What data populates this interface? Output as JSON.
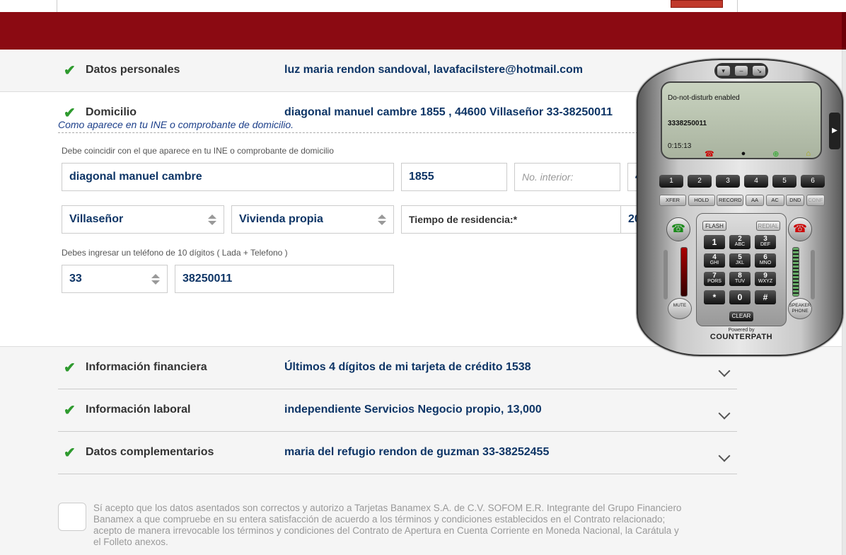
{
  "colors": {
    "brand_red": "#8b0a12",
    "value_blue": "#0e3566",
    "check_green": "#2e9a2e"
  },
  "sections": {
    "personal": {
      "title": "Datos personales",
      "value": "luz maria rendon sandoval, lavafacilstere@hotmail.com"
    },
    "domicilio": {
      "title": "Domicilio",
      "value": "diagonal manuel cambre 1855 , 44600 Villaseñor 33-38250011",
      "subtitle": "Como aparece en tu INE o comprobante de domicilio.",
      "helper": "Debe coincidir con el que aparece en tu INE o comprobante de domicilio",
      "street": "diagonal manuel cambre",
      "ext_number": "1855",
      "int_number_placeholder": "No. interior:",
      "partial_field": "4",
      "colonia": "Villaseñor",
      "housing": "Vivienda propia",
      "residence_label": "Tiempo de residencia:*",
      "residence_value": "20",
      "phone_helper": "Debes ingresar un teléfono de 10 dígitos ( Lada + Telefono )",
      "lada": "33",
      "phone": "38250011"
    },
    "financial": {
      "title": "Información financiera",
      "value": "Últimos 4 dígitos de mi tarjeta de crédito 1538"
    },
    "labor": {
      "title": "Información laboral",
      "value": "independiente Servicios Negocio propio, 13,000"
    },
    "complementary": {
      "title": "Datos complementarios",
      "value": "maria del refugio rendon de guzman 33-38252455"
    }
  },
  "consent": {
    "text": "Sí acepto que los datos asentados son correctos y autorizo a Tarjetas Banamex S.A. de C.V. SOFOM E.R. Integrante del Grupo Financiero Banamex a que compruebe en su entera satisfacción de acuerdo a los términos y condiciones establecidos en el Contrato relacionado; acepto de manera irrevocable los términos y condiciones del Contrato de Apertura en Cuenta Corriente en Moneda Nacional, la Carátula y el Folleto anexos."
  },
  "softphone": {
    "status": "Do-not-disturb enabled",
    "number": "3338250011",
    "timer": "0:15:13",
    "lines": [
      "1",
      "2",
      "3",
      "4",
      "5",
      "6"
    ],
    "features": [
      "XFER",
      "HOLD",
      "RECORD",
      "AA",
      "AC",
      "DND",
      "CONF"
    ],
    "flash": "FLASH",
    "redial": "REDIAL",
    "keys": [
      {
        "d": "1",
        "s": ""
      },
      {
        "d": "2",
        "s": "ABC"
      },
      {
        "d": "3",
        "s": "DEF"
      },
      {
        "d": "4",
        "s": "GHI"
      },
      {
        "d": "5",
        "s": "JKL"
      },
      {
        "d": "6",
        "s": "MNO"
      },
      {
        "d": "7",
        "s": "PORS"
      },
      {
        "d": "8",
        "s": "TUV"
      },
      {
        "d": "9",
        "s": "WXYZ"
      },
      {
        "d": "*",
        "s": ""
      },
      {
        "d": "0",
        "s": ""
      },
      {
        "d": "#",
        "s": ""
      }
    ],
    "clear": "CLEAR",
    "mute": "MUTE",
    "speaker": "SPEAKER PHONE",
    "powered_by": "Powered by",
    "brand": "COUNTERPATH"
  }
}
